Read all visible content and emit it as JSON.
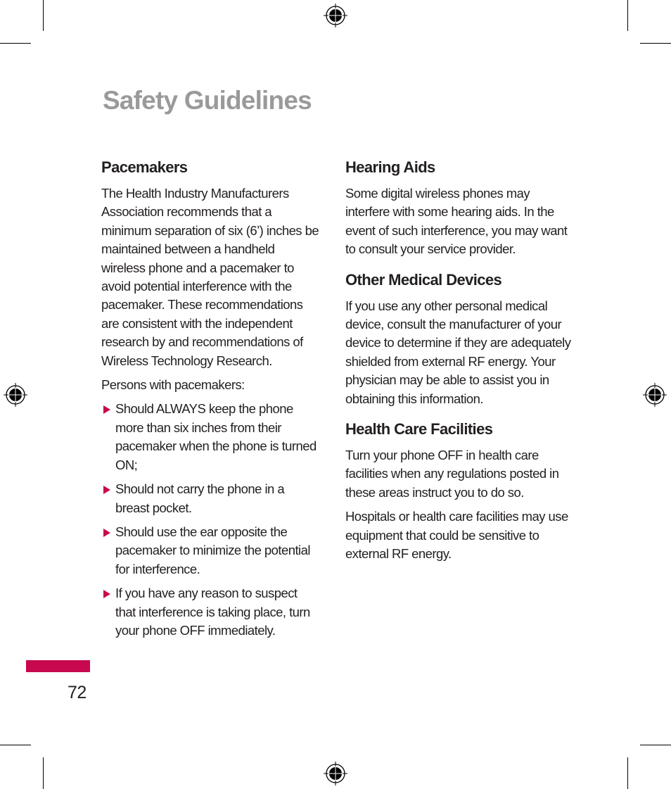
{
  "page": {
    "title": "Safety Guidelines",
    "page_number": "72",
    "accent_color": "#c8084f",
    "title_color": "#9a9a9a"
  },
  "left_column": {
    "pacemakers": {
      "heading": "Pacemakers",
      "paragraph": "The Health Industry Manufacturers Association recommends that a minimum separation of six (6’) inches be maintained between a handheld wireless phone and a pacemaker to avoid potential interference with the pacemaker. These recommendations are consistent with the independent research by and recommendations of Wireless Technology Research.",
      "intro": "Persons with pacemakers:",
      "bullets": [
        "Should ALWAYS keep the phone more than six inches from their pacemaker when the phone is turned ON;",
        "Should not carry the phone in a breast pocket.",
        "Should use the ear opposite the pacemaker to minimize the potential for interference.",
        "If you have any reason to suspect that interference is taking place, turn your phone OFF immediately."
      ]
    }
  },
  "right_column": {
    "hearing_aids": {
      "heading": "Hearing Aids",
      "paragraph": "Some digital wireless phones may interfere with some hearing aids. In the event of such interference, you may want to consult your service provider."
    },
    "other_medical_devices": {
      "heading": "Other Medical Devices",
      "paragraph": "If you use any other personal medical device, consult the manufacturer of your device to determine if they are adequately shielded from external RF energy. Your physician may be able to assist you in obtaining this information."
    },
    "health_care_facilities": {
      "heading": "Health Care Facilities",
      "paragraphs": [
        "Turn your phone OFF in health care facilities when any regulations posted in these areas instruct you to do so.",
        "Hospitals or health care facilities may use equipment that could be sensitive to external RF energy."
      ]
    }
  },
  "icons": {
    "registration_mark": "registration-mark-icon",
    "bullet": "triangle-right-icon"
  }
}
